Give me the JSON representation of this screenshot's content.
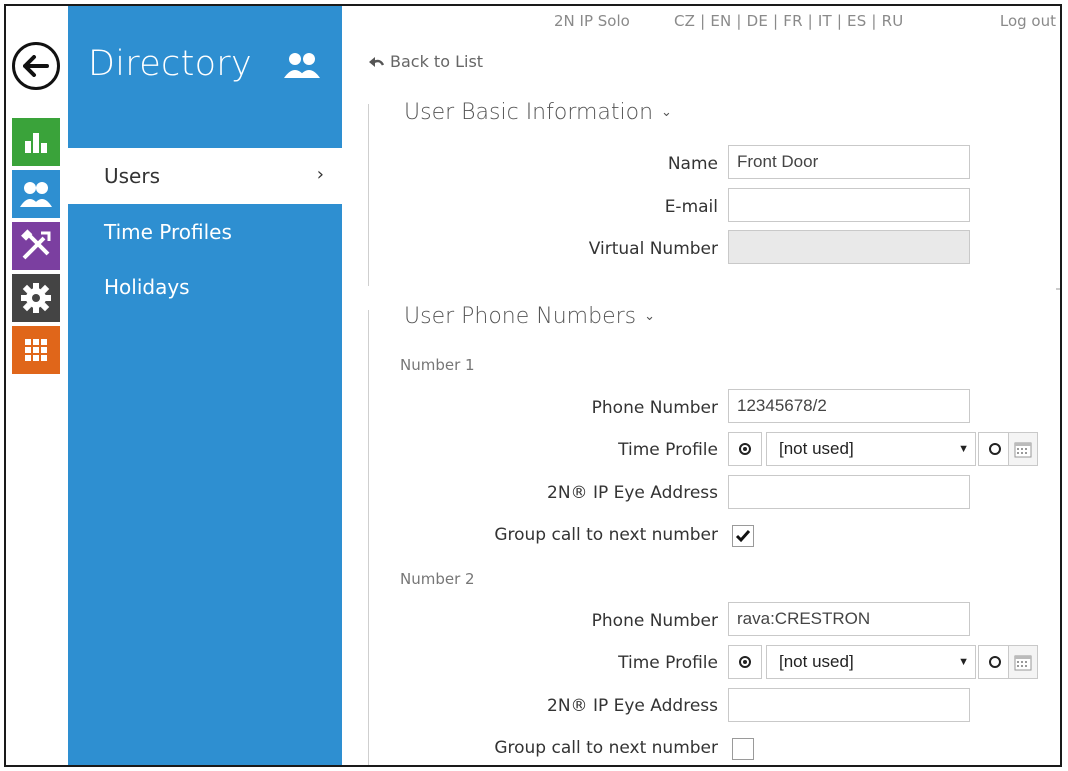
{
  "topbar": {
    "device": "2N IP Solo",
    "languages": "CZ | EN | DE | FR | IT | ES | RU",
    "logout": "Log out"
  },
  "sidebar": {
    "title": "Directory",
    "items": [
      {
        "label": "Users",
        "active": true
      },
      {
        "label": "Time Profiles",
        "active": false
      },
      {
        "label": "Holidays",
        "active": false
      }
    ]
  },
  "nav_icons": [
    "back-arrow-icon",
    "status-chart-icon",
    "directory-users-icon",
    "hardware-tools-icon",
    "system-gear-icon",
    "services-grid-icon"
  ],
  "colors": {
    "sidebar": "#2e8fd1",
    "status": "#3aa33a",
    "hardware": "#7b3fa0",
    "system": "#444444",
    "services": "#e0661a"
  },
  "back_link": "Back to List",
  "basic_info": {
    "title": "User Basic Information",
    "name_label": "Name",
    "name_value": "Front Door",
    "email_label": "E-mail",
    "email_value": "",
    "virtual_label": "Virtual Number",
    "virtual_value": ""
  },
  "phone_numbers": {
    "title": "User Phone Numbers",
    "numbers": [
      {
        "heading": "Number 1",
        "phone_label": "Phone Number",
        "phone_value": "12345678/2",
        "profile_label": "Time Profile",
        "profile_value": "[not used]",
        "eye_label": "2N® IP Eye Address",
        "eye_value": "",
        "group_label": "Group call to next number",
        "group_checked": true
      },
      {
        "heading": "Number 2",
        "phone_label": "Phone Number",
        "phone_value": "rava:CRESTRON",
        "profile_label": "Time Profile",
        "profile_value": "[not used]",
        "eye_label": "2N® IP Eye Address",
        "eye_value": "",
        "group_label": "Group call to next number",
        "group_checked": false
      }
    ]
  }
}
